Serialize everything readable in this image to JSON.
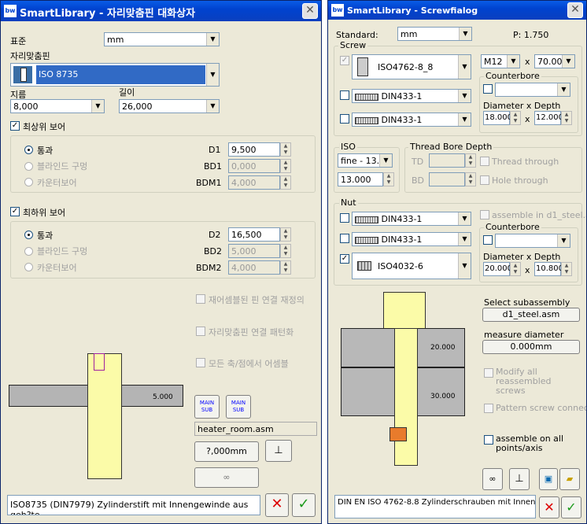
{
  "left": {
    "title": "SmartLibrary - 자리맞춤핀 대화상자",
    "standard_label": "표준",
    "standard_value": "mm",
    "part_label": "자리맞춤핀",
    "part_value": "ISO 8735",
    "diameter_label": "지름",
    "diameter_value": "8,000",
    "length_label": "길이",
    "length_value": "26,000",
    "top_check_label": "최상위 보어",
    "top": {
      "opt1": "통과",
      "opt2": "블라인드 구멍",
      "opt3": "카운터보어",
      "l1": "D1",
      "v1": "9,500",
      "l2": "BD1",
      "v2": "0,000",
      "l3": "BDM1",
      "v3": "4,000"
    },
    "bottom_check_label": "최하위 보어",
    "bottom": {
      "opt1": "통과",
      "opt2": "블라인드 구멍",
      "opt3": "카운터보어",
      "l1": "D2",
      "v1": "16,500",
      "l2": "BD2",
      "v2": "5,000",
      "l3": "BDM2",
      "v3": "4,000"
    },
    "opt_reassemble": "재어셈블된 핀 연결 재정의",
    "opt_pattern": "자리맞춤핀 연결 패턴화",
    "opt_all_axes": "모든 축/점에서 어셈블",
    "dim_label": "5.000",
    "main_sub_a": "MAIN\nSUB",
    "main_sub_b": "MAIN\nSUB",
    "assembly_name": "heater_room.asm",
    "measure_value": "?,000mm",
    "status": "ISO8735 (DIN7979) Zylinderstift mit Innengewinde aus geh?te"
  },
  "right": {
    "title": "SmartLibrary - Screwfialog",
    "standard_label": "Standard:",
    "standard_value": "mm",
    "p_label": "P: 1.750",
    "screw_group": "Screw",
    "screw1": "ISO4762-8_8",
    "screw2": "DIN433-1",
    "screw3": "DIN433-1",
    "size": "M12",
    "x_label": "x",
    "length": "70.000",
    "counterbore_label": "Counterbore",
    "diam_depth_label": "Diameter x Depth",
    "cb_d": "18.000",
    "cb_depth": "12.000",
    "iso_group": "ISO",
    "iso_thread": "fine - 13.0",
    "iso_value": "13.000",
    "tbd_group": "Thread Bore Depth",
    "td": "TD",
    "bd": "BD",
    "thread_through": "Thread through",
    "hole_through": "Hole through",
    "nut_group": "Nut",
    "nut1": "DIN433-1",
    "nut2": "DIN433-1",
    "nut3": "ISO4032-6",
    "assemble_d1": "assemble in d1_steel.asm",
    "nut_counterbore": "Counterbore",
    "nut_diam_depth": "Diameter x Depth",
    "nut_d": "20.000",
    "nut_depth": "10.800",
    "select_sub_label": "Select subassembly",
    "subassembly": "d1_steel.asm",
    "measure_label": "measure diameter",
    "measure_value": "0.000mm",
    "modify_label": "Modify all reassembled screws",
    "pattern_label": "Pattern screw connection",
    "assemble_all": "assemble on all points/axis",
    "dim_top": "20.000",
    "dim_bottom": "30.000",
    "status": "DIN EN ISO 4762-8.8 Zylinderschrauben mit Innensechkant"
  }
}
